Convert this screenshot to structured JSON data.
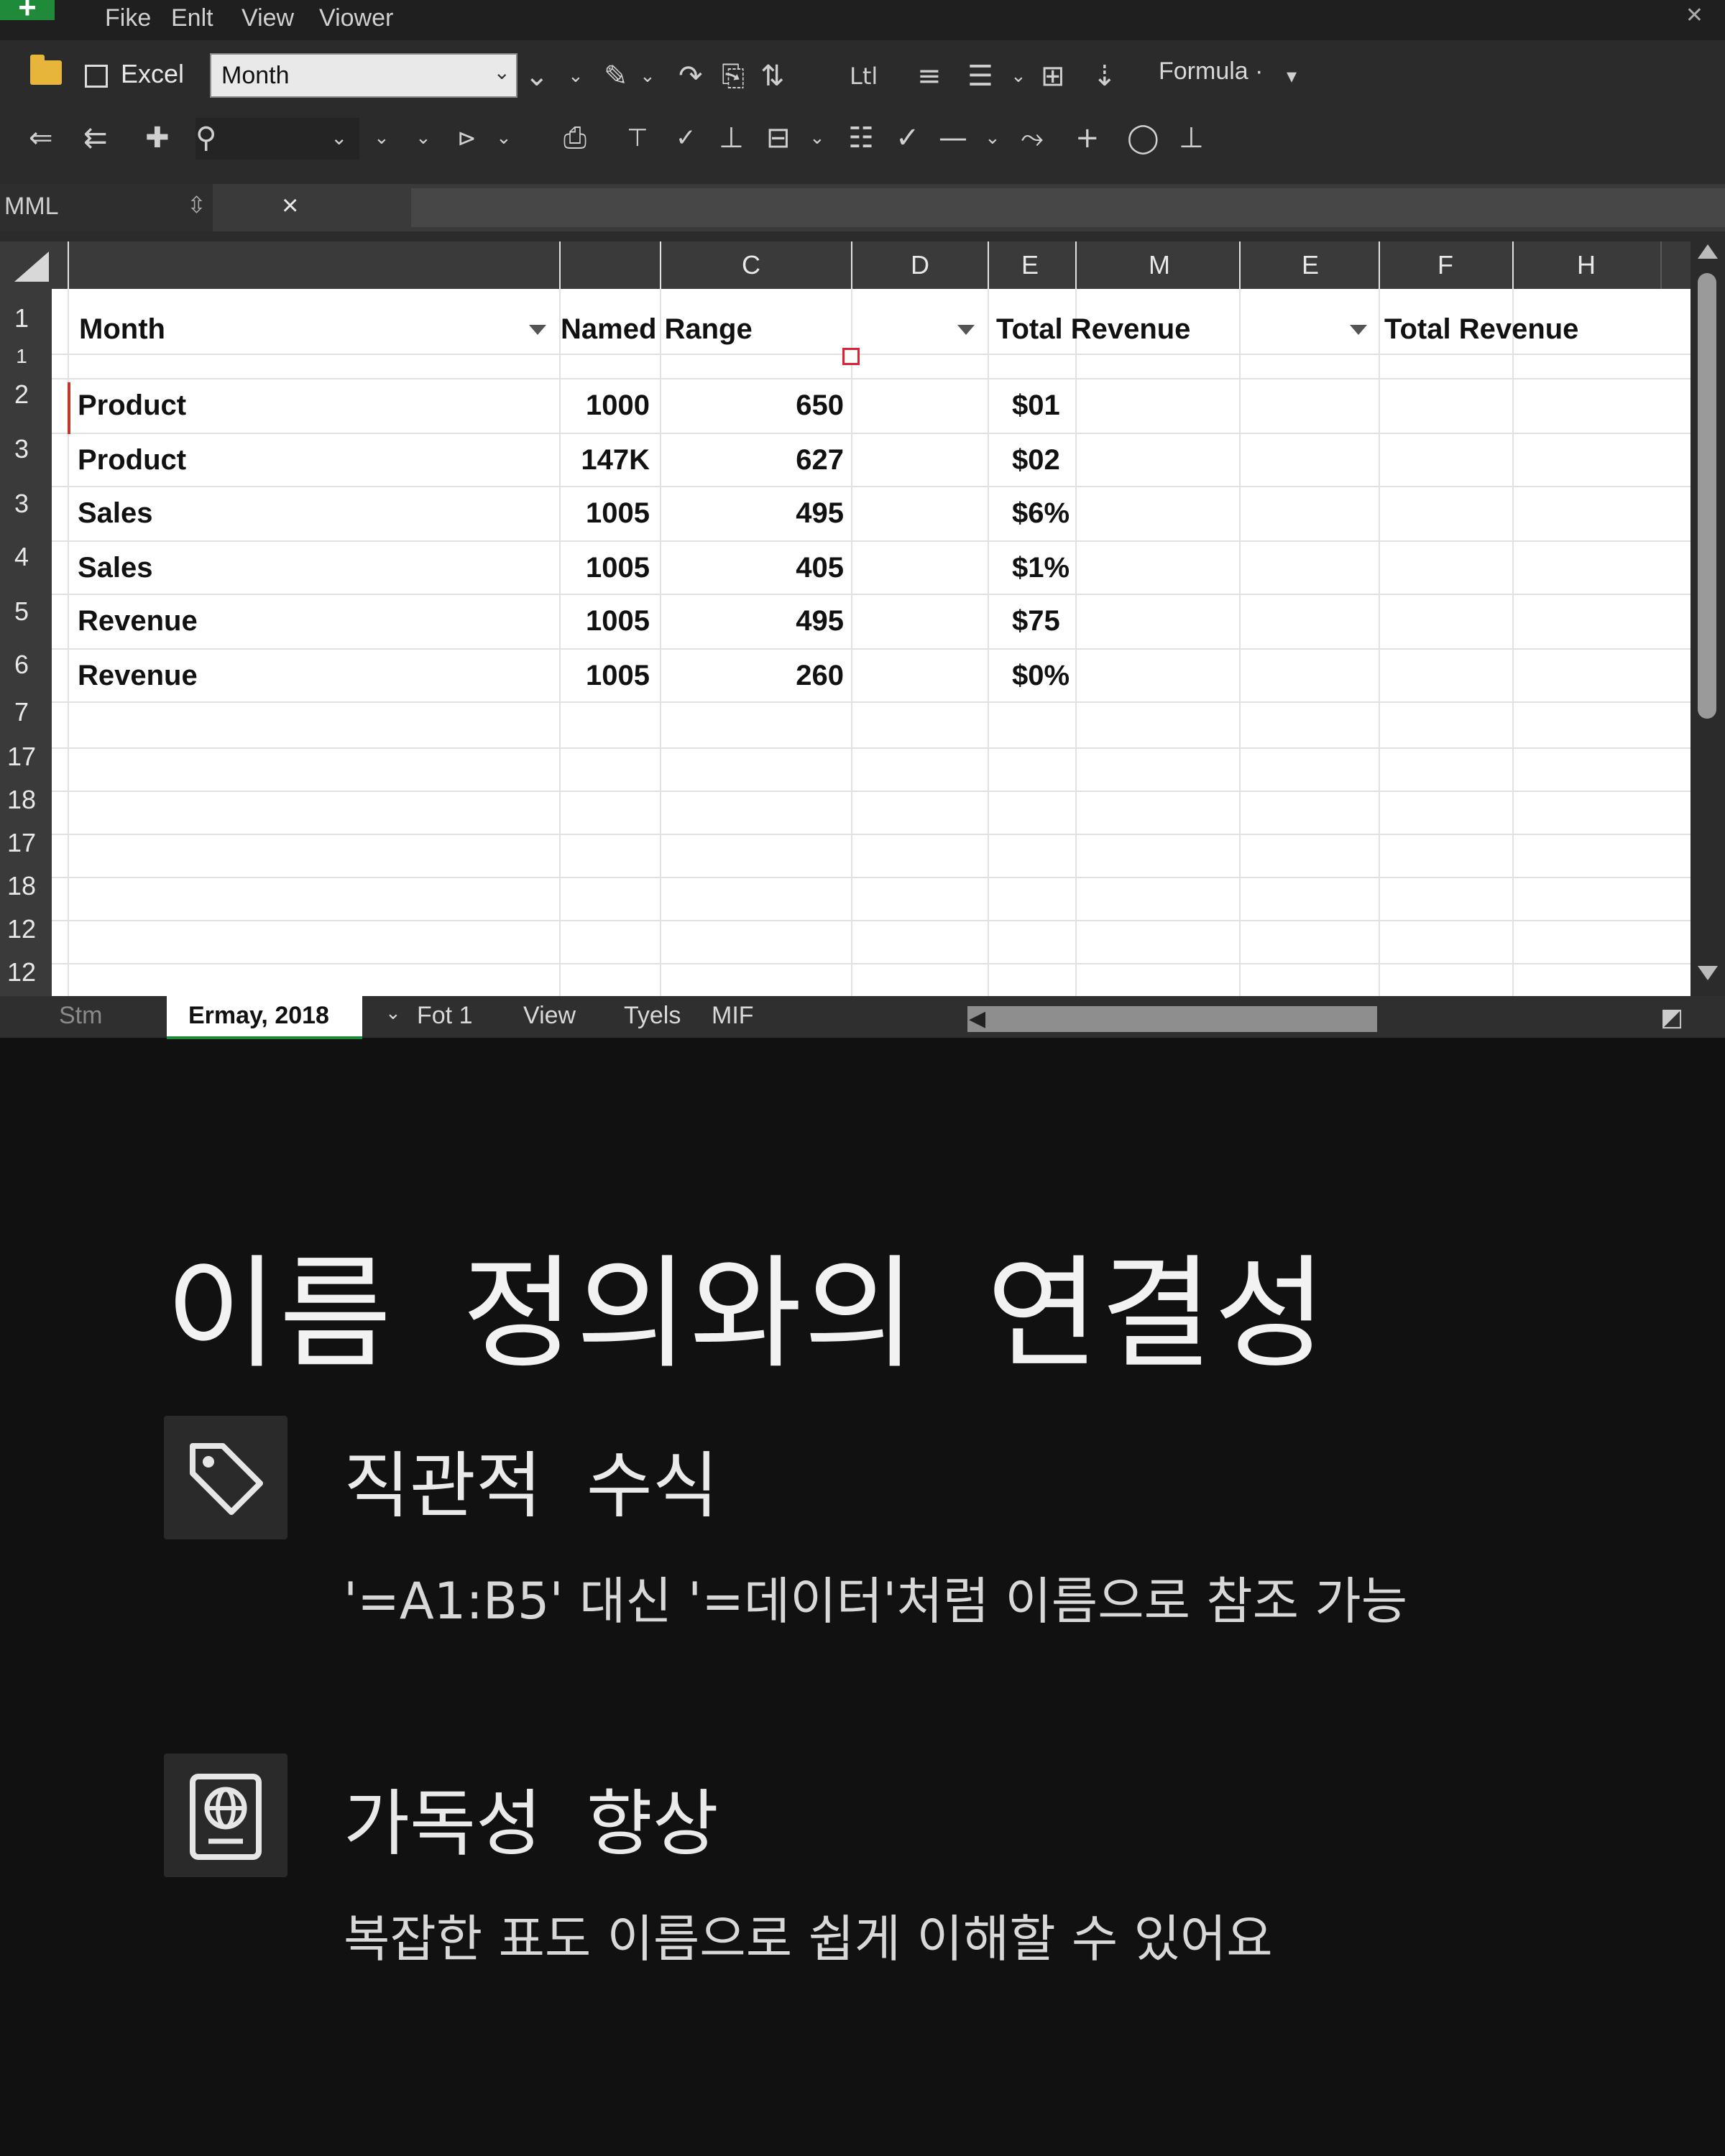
{
  "menubar": {
    "plus": "+",
    "items": [
      "Fike",
      "Enlt",
      "View",
      "Viower"
    ]
  },
  "toolbar": {
    "excel_label": "Excel",
    "month_combo_value": "Month",
    "formula_label": "Formula ·",
    "group_label": "Ltl"
  },
  "namebox": {
    "value": "MML",
    "cancel_symbol": "×"
  },
  "columns": [
    "C",
    "D",
    "E",
    "M",
    "E",
    "F",
    "H"
  ],
  "row_numbers": [
    "1",
    "1",
    "2",
    "3",
    "3",
    "4",
    "5",
    "6",
    "7",
    "17",
    "18",
    "17",
    "18",
    "12",
    "12"
  ],
  "table": {
    "headers": [
      "Month",
      "Named Range",
      "Total Revenue",
      "Total Revenue"
    ],
    "rows": [
      {
        "label": "Product",
        "b": "1000",
        "c": "650",
        "e": "$01"
      },
      {
        "label": "Product",
        "b": "147K",
        "c": "627",
        "e": "$02"
      },
      {
        "label": "Sales",
        "b": "1005",
        "c": "495",
        "e": "$6%"
      },
      {
        "label": "Sales",
        "b": "1005",
        "c": "405",
        "e": "$1%"
      },
      {
        "label": "Revenue",
        "b": "1005",
        "c": "495",
        "e": "$75"
      },
      {
        "label": "Revenue",
        "b": "1005",
        "c": "260",
        "e": "$0%"
      }
    ]
  },
  "sheet_tabs": {
    "left": "Stm",
    "active": "Ermay, 2018",
    "others": [
      "Fot 1",
      "View",
      "Tyels",
      "MIF"
    ]
  },
  "caption": {
    "headline": "이름 정의와의 연결성",
    "features": [
      {
        "icon": "tag-icon",
        "title": "직관적 수식",
        "desc": "'=A1:B5' 대신 '=데이터'처럼 이름으로 참조 가능"
      },
      {
        "icon": "globe-card-icon",
        "title": "가독성 향상",
        "desc": "복잡한 표도 이름으로 쉽게 이해할 수 있어요"
      }
    ]
  },
  "colors": {
    "background": "#111111",
    "excel_green": "#1f8a3a",
    "grid_bg": "#ffffff",
    "chrome": "#2b2b2b"
  }
}
